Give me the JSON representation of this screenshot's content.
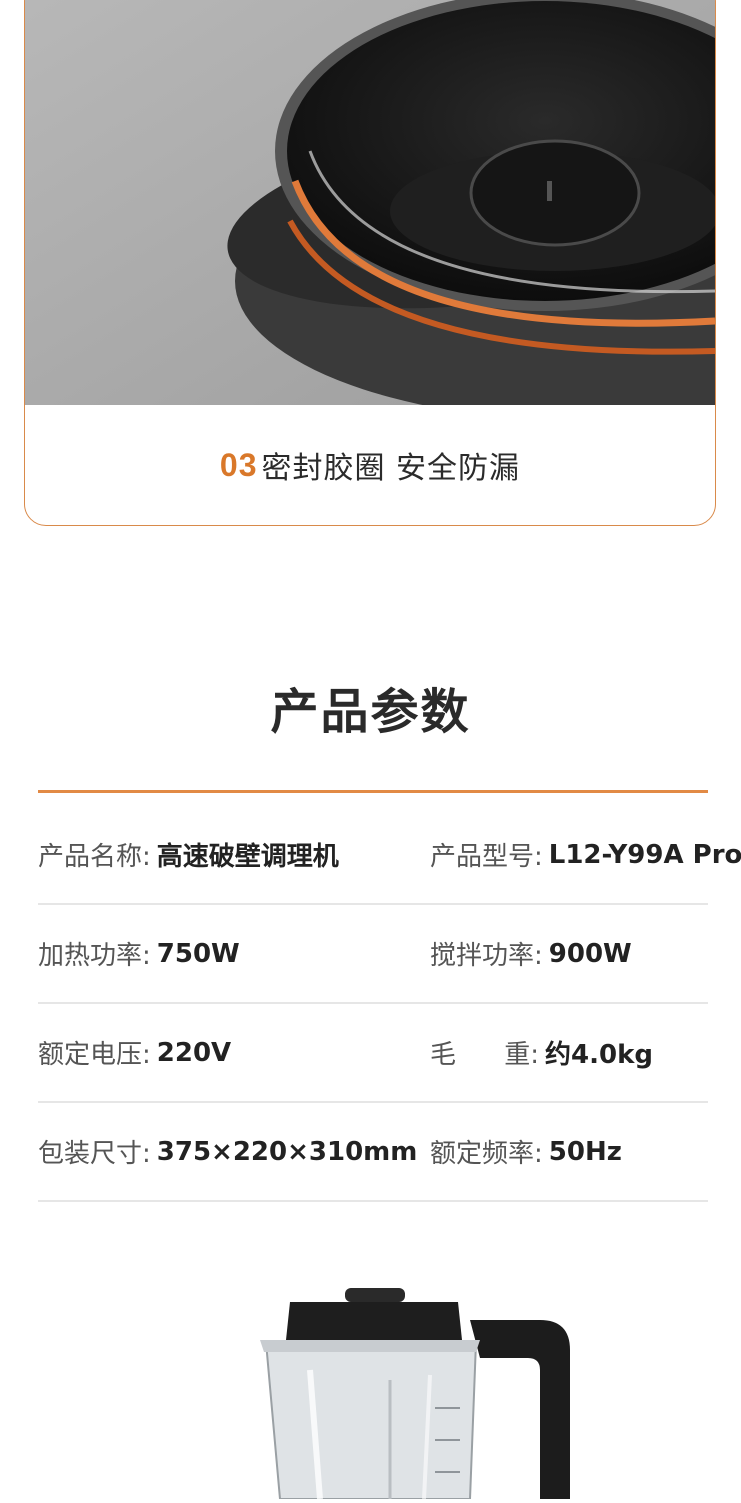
{
  "feature": {
    "number": "03",
    "caption": "密封胶圈 安全防漏"
  },
  "params": {
    "title": "产品参数",
    "rows": [
      {
        "left_label": "产品名称:",
        "left_value": "高速破壁调理机",
        "right_label": "产品型号:",
        "right_value": "L12-Y99A Pro"
      },
      {
        "left_label": "加热功率:",
        "left_value": "750W",
        "right_label": "搅拌功率:",
        "right_value": "900W"
      },
      {
        "left_label": "额定电压:",
        "left_value": "220V",
        "right_label": "毛 重:",
        "right_value": "约4.0kg"
      },
      {
        "left_label": "包装尺寸:",
        "left_value": "375×220×310mm",
        "right_label": "额定频率:",
        "right_value": "50Hz"
      }
    ]
  },
  "colors": {
    "accent": "#e28a45",
    "text": "#2a2a2a"
  }
}
